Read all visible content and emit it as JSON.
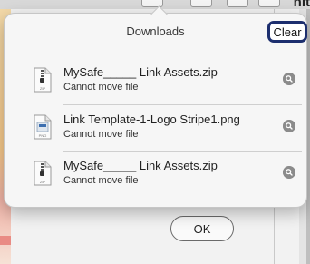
{
  "background": {
    "partial_text": "nit",
    "ok_label": "OK"
  },
  "downloads": {
    "title": "Downloads",
    "clear_label": "Clear",
    "items": [
      {
        "name": "MySafe_____ Link Assets.zip",
        "status": "Cannot move file",
        "type": "zip",
        "icon": "zip-file-icon"
      },
      {
        "name": "Link Template-1-Logo Stripe1.png",
        "status": "Cannot move file",
        "type": "png",
        "icon": "png-file-icon"
      },
      {
        "name": "MySafe_____ Link Assets.zip",
        "status": "Cannot move file",
        "type": "zip",
        "icon": "zip-file-icon"
      }
    ]
  }
}
